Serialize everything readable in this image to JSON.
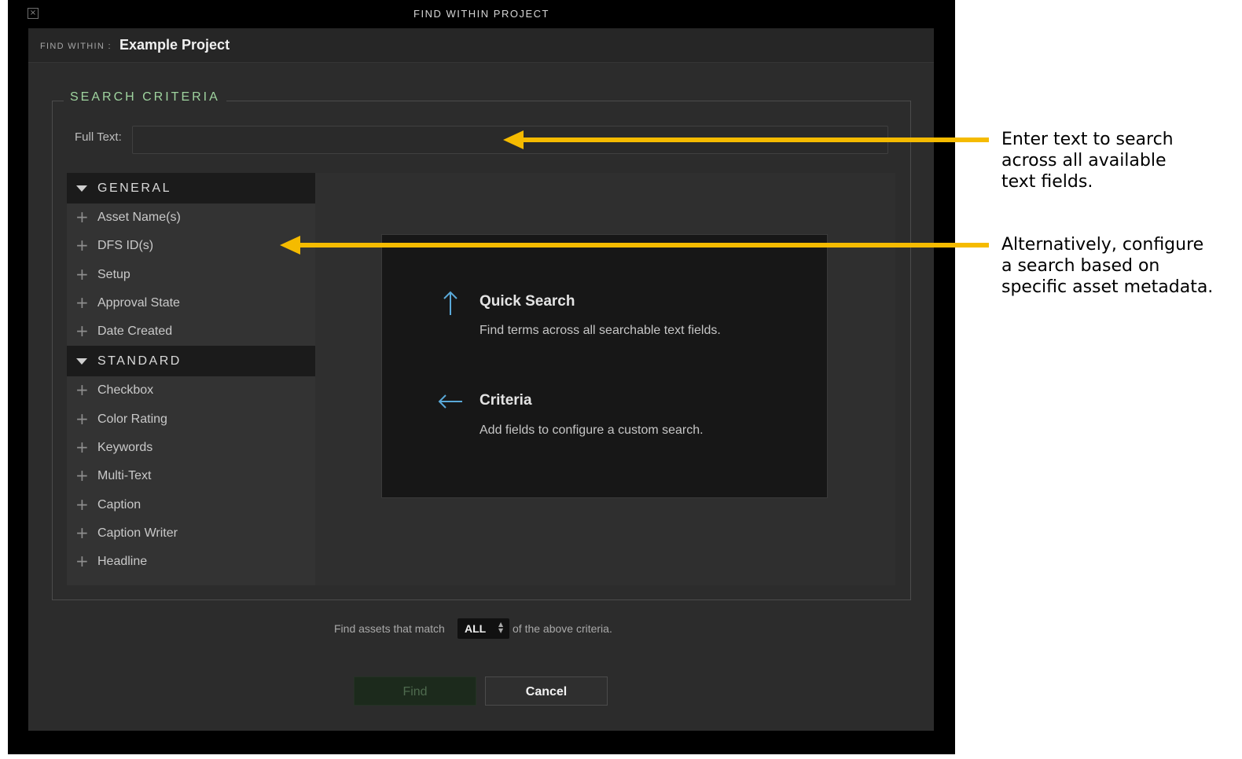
{
  "window": {
    "title": "FIND WITHIN PROJECT",
    "close_glyph": "×"
  },
  "header": {
    "find_within_label": "FIND WITHIN :",
    "project_name": "Example Project"
  },
  "criteria": {
    "legend": "SEARCH CRITERIA",
    "full_text_label": "Full Text:",
    "full_text_value": "",
    "full_text_placeholder": ""
  },
  "sections": {
    "general": {
      "label": "GENERAL",
      "items": [
        "Asset Name(s)",
        "DFS ID(s)",
        "Setup",
        "Approval State",
        "Date Created"
      ]
    },
    "standard": {
      "label": "STANDARD",
      "items": [
        "Checkbox",
        "Color Rating",
        "Keywords",
        "Multi-Text",
        "Caption",
        "Caption Writer",
        "Headline"
      ]
    }
  },
  "info": {
    "quick_search_title": "Quick Search",
    "quick_search_text": "Find terms across all searchable text fields.",
    "criteria_title": "Criteria",
    "criteria_text": "Add fields to configure a custom search."
  },
  "match": {
    "prefix": "Find assets that match",
    "value": "ALL",
    "suffix": "of the above criteria."
  },
  "buttons": {
    "find": "Find",
    "cancel": "Cancel"
  },
  "annotations": {
    "first": [
      "Enter text to search",
      "across all available",
      "text fields."
    ],
    "second": [
      "Alternatively, configure",
      "a search based on",
      "specific asset metadata."
    ]
  },
  "colors": {
    "accent_green": "#9fd49f",
    "arrow_yellow": "#f5bb00",
    "info_arrow_blue": "#5aa9d8",
    "dialog_bg": "#2c2c2c"
  }
}
